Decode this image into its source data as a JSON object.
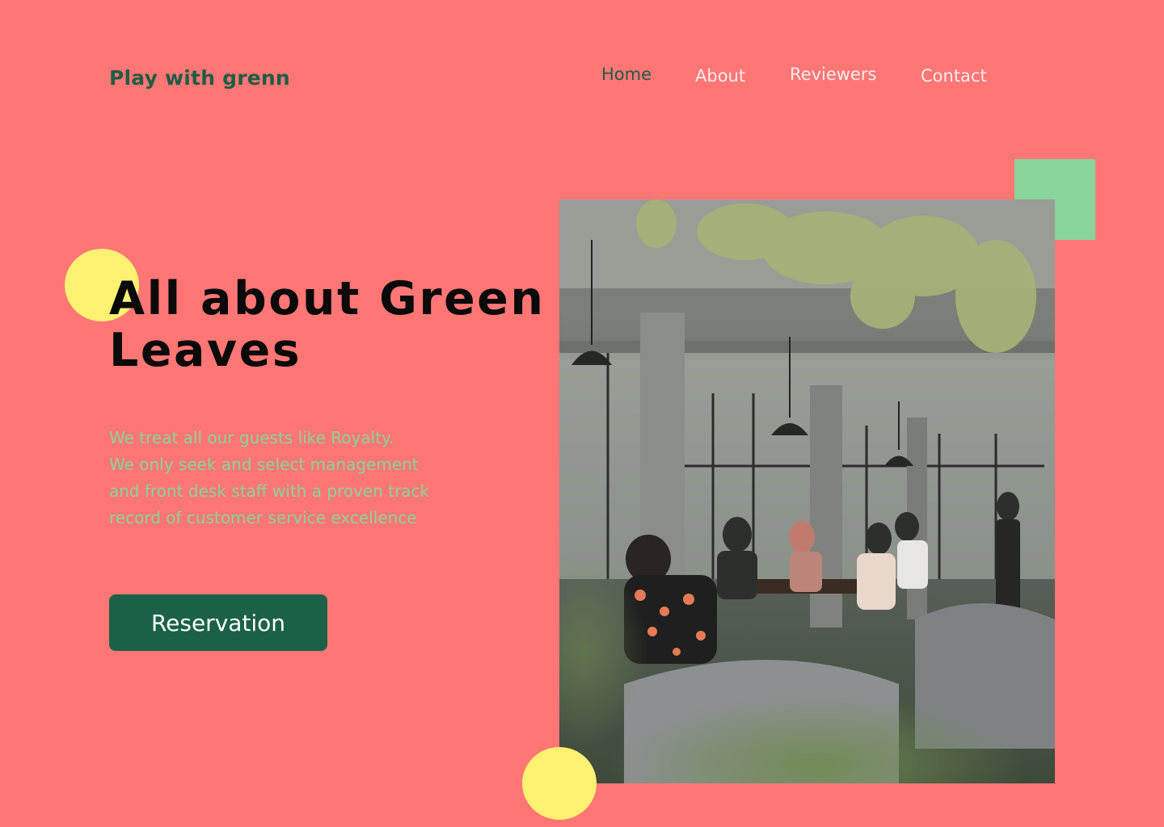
{
  "brand": {
    "name": "Play with grenn"
  },
  "nav": {
    "items": [
      {
        "label": "Home",
        "active": true
      },
      {
        "label": "About",
        "active": false
      },
      {
        "label": "Reviewers",
        "active": false
      },
      {
        "label": "Contact",
        "active": false
      }
    ]
  },
  "hero": {
    "headline": "All about Green Leaves",
    "description_lines": [
      "We treat all our guests like Royalty.",
      "We only seek and select management",
      "and front desk staff with a proven track",
      "record of customer service excellence"
    ],
    "cta_label": "Reservation"
  },
  "colors": {
    "background": "#ff7675",
    "brand_green": "#1f5c45",
    "accent_green": "#88d49a",
    "accent_yellow": "#fdf171",
    "button": "#1a6148"
  },
  "image": {
    "subject": "cafe-interior-with-hanging-plants"
  }
}
